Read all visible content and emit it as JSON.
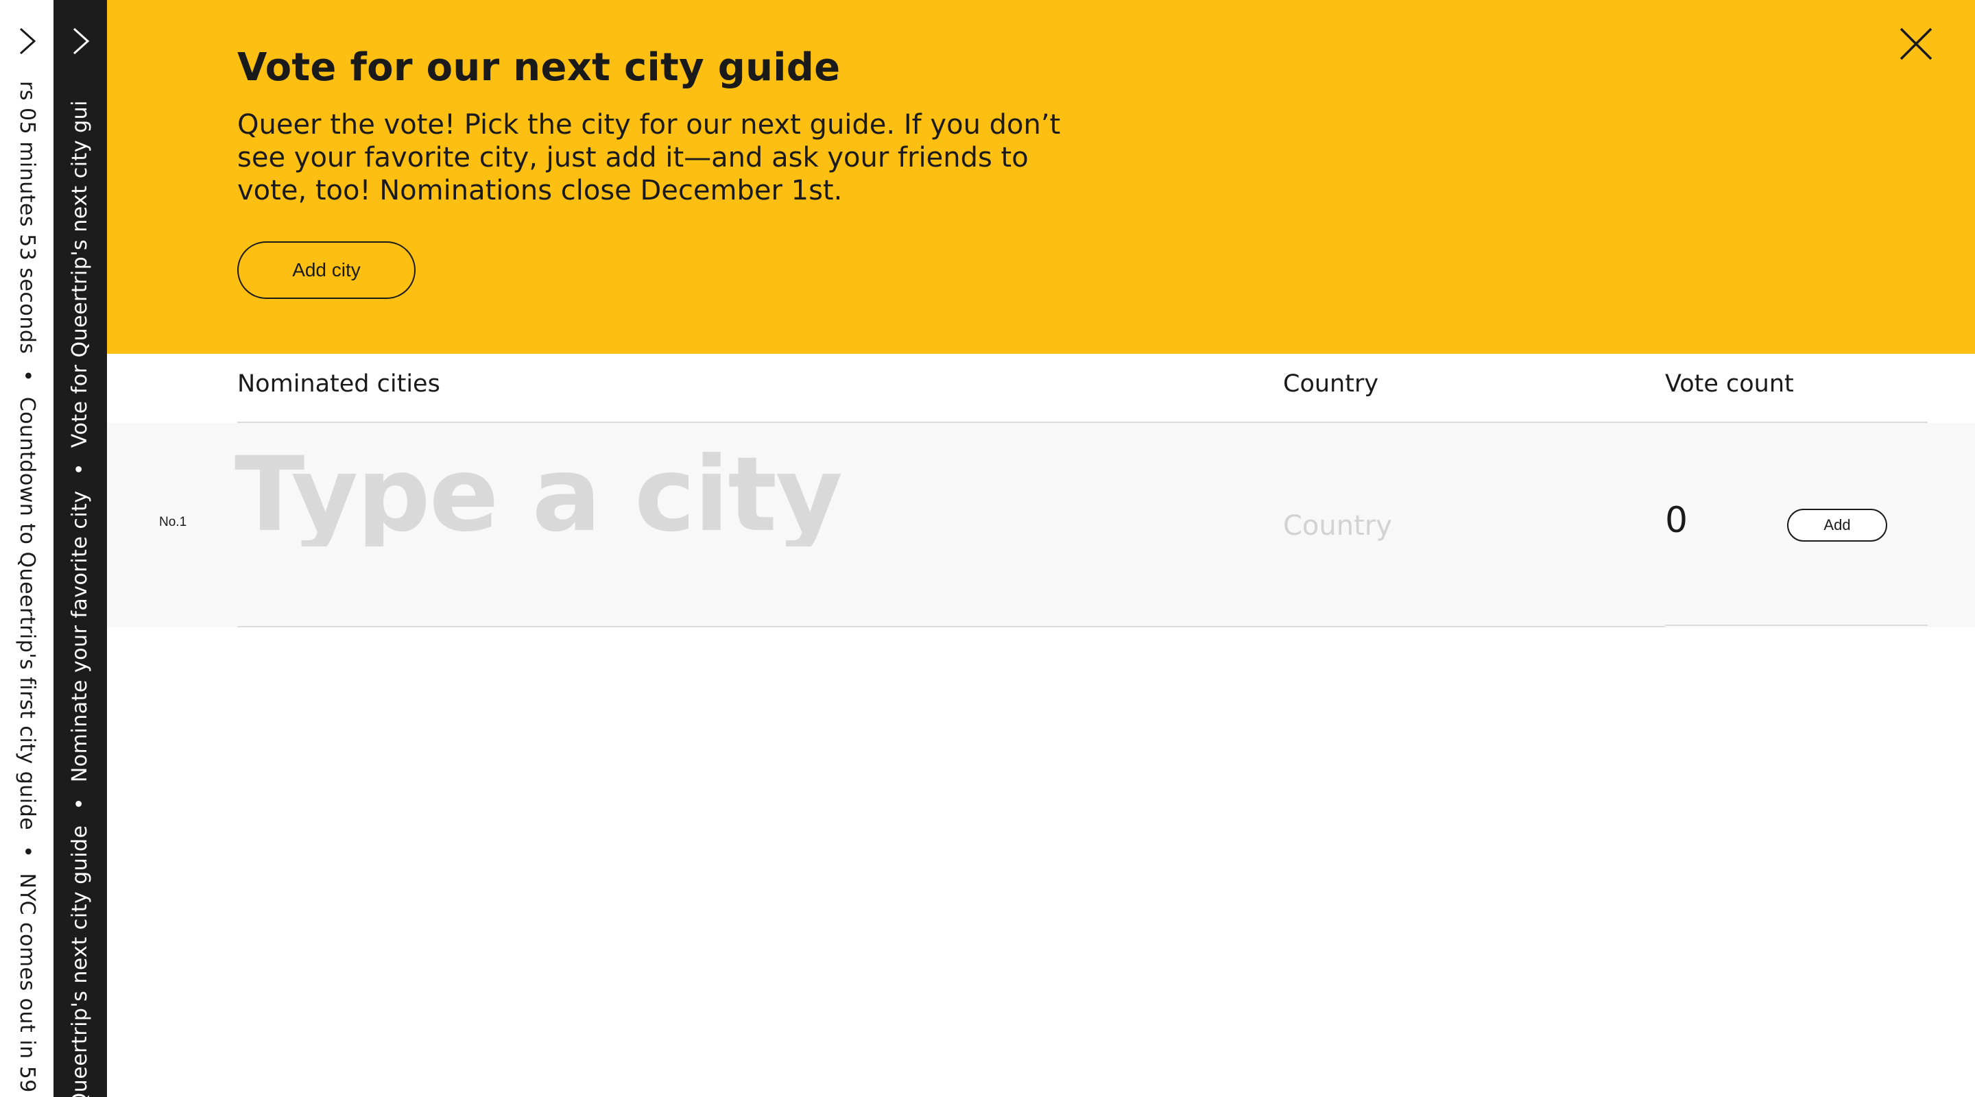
{
  "rails": {
    "light": {
      "ticker": [
        "rs 05 minutes 53 seconds",
        "•",
        "Countdown to Queertrip's first city guide",
        "•",
        "NYC comes out in 59"
      ]
    },
    "dark": {
      "ticker": [
        "r Queertrip's next city guide",
        "•",
        "Nominate your favorite city",
        "•",
        "Vote for Queertrip's next city gui"
      ]
    },
    "chevron_icon": "chevron-right-icon"
  },
  "banner": {
    "title": "Vote for our next city guide",
    "description": "Queer the vote! Pick the city for our next guide. If you don’t see your favorite city, just add it—and ask your friends to vote, too! Nominations close December 1st.",
    "add_city_label": "Add city",
    "close_icon": "close-icon",
    "background": "#fcbf12"
  },
  "table": {
    "headers": {
      "city": "Nominated cities",
      "country": "Country",
      "votes": "Vote count"
    },
    "row": {
      "rank": "No.1",
      "city_placeholder": "Type a city",
      "country_placeholder": "Country",
      "votes": "0",
      "add_label": "Add"
    }
  }
}
